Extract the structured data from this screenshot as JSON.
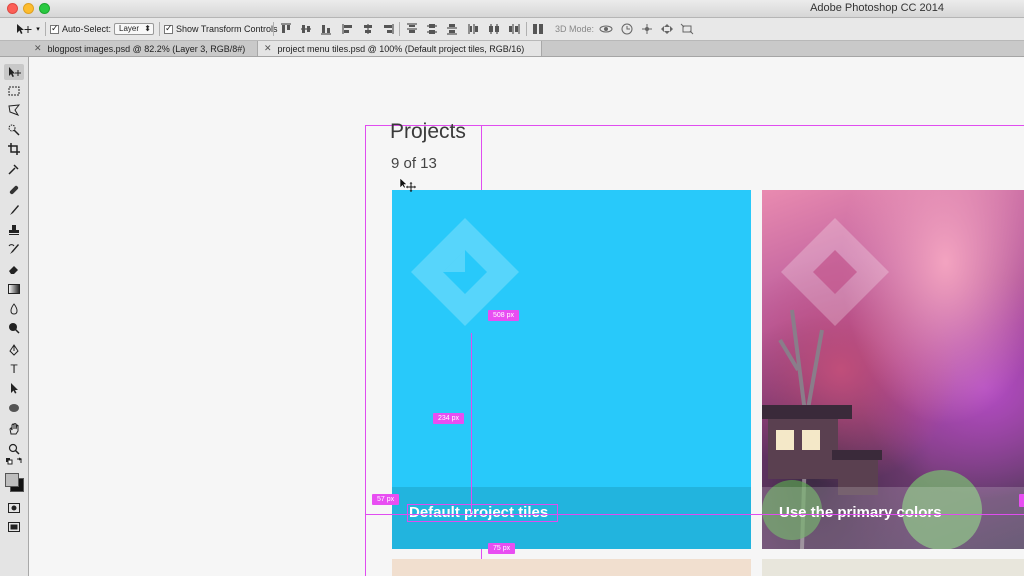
{
  "app": {
    "title": "Adobe Photoshop CC 2014"
  },
  "options_bar": {
    "auto_select_label": "Auto-Select:",
    "auto_select_value": "Layer",
    "show_transform_label": "Show Transform Controls",
    "mode_3d_label": "3D Mode:"
  },
  "tabs": [
    {
      "label": "blogpost images.psd @ 82.2% (Layer 3, RGB/8#)",
      "active": false
    },
    {
      "label": "project menu tiles.psd @ 100% (Default project tiles, RGB/16)",
      "active": true
    }
  ],
  "document": {
    "heading": "Projects",
    "count": "9 of 13",
    "tiles": [
      {
        "caption": "Default project tiles",
        "color": "#28c9fa"
      },
      {
        "caption": "Use the primary colors"
      }
    ]
  },
  "measurements": {
    "width_label": "508 px",
    "height_label": "234 px",
    "left_label": "57 px",
    "bottom_label": "75 px"
  },
  "colors": {
    "guide": "#e04cf0",
    "tile_blue": "#28c9fa"
  }
}
